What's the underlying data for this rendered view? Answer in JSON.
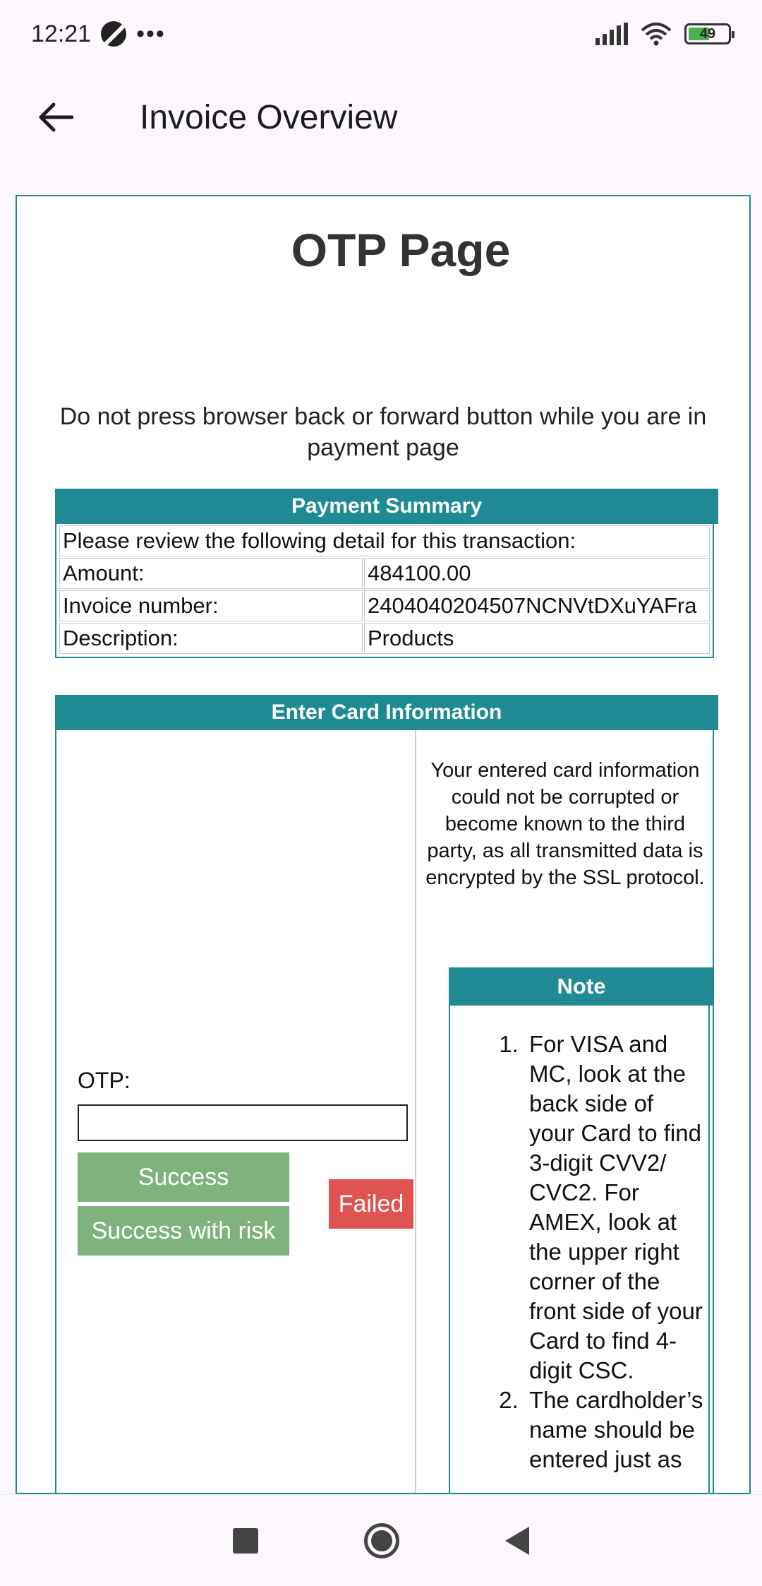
{
  "status_bar": {
    "time": "12:21",
    "more": "•••",
    "battery_level": "49"
  },
  "app_bar": {
    "title": "Invoice Overview"
  },
  "page": {
    "title": "OTP Page",
    "warning": "Do not press browser back or forward button while you are in payment page"
  },
  "payment_summary": {
    "heading": "Payment Summary",
    "intro": "Please review the following detail for this transaction:",
    "rows": [
      {
        "label": "Amount:",
        "value": "484100.00"
      },
      {
        "label": "Invoice number:",
        "value": "2404040204507NCNVtDXuYAFra"
      },
      {
        "label": "Description:",
        "value": "Products"
      }
    ]
  },
  "card_info": {
    "heading": "Enter Card Information",
    "otp_label": "OTP:",
    "otp_value": "",
    "buttons": {
      "success": "Success",
      "success_risk": "Success with risk",
      "failed": "Failed"
    },
    "ssl_note": "Your entered card information could not be corrupted or become known to the third party, as all transmitted data is encrypted by the SSL protocol.",
    "note_heading": "Note",
    "notes": [
      "For VISA and MC, look at the back side of your Card to find 3-digit CVV2/ CVC2. For AMEX, look at the upper right corner of the front side of your Card to find 4-digit CSC.",
      "The cardholder’s name should be entered just as"
    ]
  },
  "colors": {
    "accent": "#1f8a94",
    "success": "#80b27d",
    "failed": "#df5350"
  }
}
